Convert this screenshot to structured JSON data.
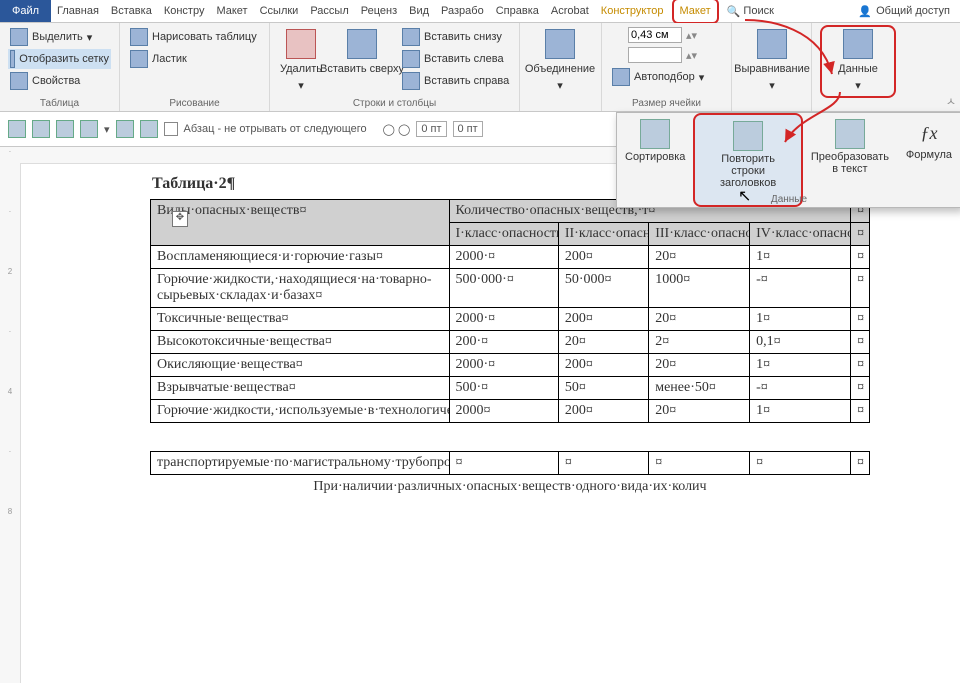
{
  "tabs": {
    "file": "Файл",
    "items": [
      "Главная",
      "Вставка",
      "Констру",
      "Макет",
      "Ссылки",
      "Рассыл",
      "Реценз",
      "Вид",
      "Разрабо",
      "Справка",
      "Acrobat"
    ],
    "constructor": "Конструктор",
    "layout": "Макет",
    "search": "Поиск",
    "share": "Общий доступ"
  },
  "ribbon": {
    "table_group": "Таблица",
    "select": "Выделить",
    "show_grid": "Отобразить сетку",
    "properties": "Свойства",
    "drawing_group": "Рисование",
    "draw_table": "Нарисовать таблицу",
    "eraser": "Ластик",
    "rows_cols_group": "Строки и столбцы",
    "delete": "Удалить",
    "insert_top": "Вставить сверху",
    "insert_below": "Вставить снизу",
    "insert_left": "Вставить слева",
    "insert_right": "Вставить справа",
    "merge_group": "Объединение",
    "cell_size_group": "Размер ячейки",
    "height": "0,43 см",
    "autofit": "Автоподбор",
    "align_group": "Выравнивание",
    "data": "Данные"
  },
  "popup": {
    "sort": "Сортировка",
    "repeat_headers": "Повторить строки заголовков",
    "to_text": "Преобразовать в текст",
    "formula": "Формула",
    "group": "Данные"
  },
  "qat": {
    "paragraph": "Абзац - не отрывать от следующего",
    "pt": "0 пт"
  },
  "doc": {
    "title": "Таблица·2¶",
    "hdr_left": "Виды·опасных·веществ¤",
    "hdr_right": "Количество·опасных·веществ,·т¤",
    "sub": [
      "I·класс·опасности¤",
      "II·класс·опасности¤",
      "III·класс·опасности¤",
      "IV·класс·опасности¤"
    ],
    "rows": [
      {
        "name": "Воспламеняющиеся·и·горючие·газы¤",
        "c": [
          "2000·¤",
          "200¤",
          "20¤",
          "1¤"
        ]
      },
      {
        "name": "Горючие·жидкости,·находящиеся·на·товарно-сырьевых·складах·и·базах¤",
        "c": [
          "500·000·¤",
          "50·000¤",
          "1000¤",
          "-¤"
        ]
      },
      {
        "name": "Токсичные·вещества¤",
        "c": [
          "2000·¤",
          "200¤",
          "20¤",
          "1¤"
        ]
      },
      {
        "name": "Высокотоксичные·вещества¤",
        "c": [
          "200·¤",
          "20¤",
          "2¤",
          "0,1¤"
        ]
      },
      {
        "name": "Окисляющие·вещества¤",
        "c": [
          "2000·¤",
          "200¤",
          "20¤",
          "1¤"
        ]
      },
      {
        "name": "Взрывчатые·вещества¤",
        "c": [
          "500·¤",
          "50¤",
          "менее·50¤",
          "-¤"
        ]
      },
      {
        "name": "Горючие·жидкости,·используемые·в·технологическом·процессе·или·",
        "c": [
          "2000¤",
          "200¤",
          "20¤",
          "1¤"
        ]
      }
    ],
    "row2": "транспортируемые·по·магистральному·трубопроводу¤",
    "footer": "При·наличии·различных·опасных·веществ·одного·вида·их·колич"
  }
}
